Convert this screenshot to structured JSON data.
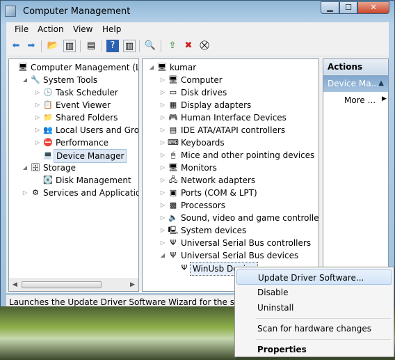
{
  "window": {
    "title": "Computer Management"
  },
  "menubar": {
    "items": [
      "File",
      "Action",
      "View",
      "Help"
    ]
  },
  "left_tree": [
    {
      "label": "Computer Management (Local",
      "indent": 0,
      "expander": "",
      "icon": "computer-icon"
    },
    {
      "label": "System Tools",
      "indent": 1,
      "expander": "◢",
      "icon": "tools-icon"
    },
    {
      "label": "Task Scheduler",
      "indent": 2,
      "expander": "▷",
      "icon": "clock-icon"
    },
    {
      "label": "Event Viewer",
      "indent": 2,
      "expander": "▷",
      "icon": "event-viewer-icon"
    },
    {
      "label": "Shared Folders",
      "indent": 2,
      "expander": "▷",
      "icon": "shared-folder-icon"
    },
    {
      "label": "Local Users and Groups",
      "indent": 2,
      "expander": "▷",
      "icon": "users-icon"
    },
    {
      "label": "Performance",
      "indent": 2,
      "expander": "▷",
      "icon": "performance-icon"
    },
    {
      "label": "Device Manager",
      "indent": 2,
      "expander": "",
      "icon": "device-manager-icon",
      "selected": true
    },
    {
      "label": "Storage",
      "indent": 1,
      "expander": "◢",
      "icon": "storage-icon"
    },
    {
      "label": "Disk Management",
      "indent": 2,
      "expander": "",
      "icon": "disk-icon"
    },
    {
      "label": "Services and Applications",
      "indent": 1,
      "expander": "▷",
      "icon": "services-icon"
    }
  ],
  "device_tree": [
    {
      "label": "kumar",
      "indent": 0,
      "expander": "◢",
      "icon": "computer-icon"
    },
    {
      "label": "Computer",
      "indent": 1,
      "expander": "▷",
      "icon": "monitor-icon"
    },
    {
      "label": "Disk drives",
      "indent": 1,
      "expander": "▷",
      "icon": "disk-drive-icon"
    },
    {
      "label": "Display adapters",
      "indent": 1,
      "expander": "▷",
      "icon": "display-adapter-icon"
    },
    {
      "label": "Human Interface Devices",
      "indent": 1,
      "expander": "▷",
      "icon": "hid-icon"
    },
    {
      "label": "IDE ATA/ATAPI controllers",
      "indent": 1,
      "expander": "▷",
      "icon": "ide-controller-icon"
    },
    {
      "label": "Keyboards",
      "indent": 1,
      "expander": "▷",
      "icon": "keyboard-icon"
    },
    {
      "label": "Mice and other pointing devices",
      "indent": 1,
      "expander": "▷",
      "icon": "mouse-icon"
    },
    {
      "label": "Monitors",
      "indent": 1,
      "expander": "▷",
      "icon": "monitor-icon"
    },
    {
      "label": "Network adapters",
      "indent": 1,
      "expander": "▷",
      "icon": "network-adapter-icon"
    },
    {
      "label": "Ports (COM & LPT)",
      "indent": 1,
      "expander": "▷",
      "icon": "port-icon"
    },
    {
      "label": "Processors",
      "indent": 1,
      "expander": "▷",
      "icon": "processor-icon"
    },
    {
      "label": "Sound, video and game controllers",
      "indent": 1,
      "expander": "▷",
      "icon": "sound-icon"
    },
    {
      "label": "System devices",
      "indent": 1,
      "expander": "▷",
      "icon": "system-device-icon"
    },
    {
      "label": "Universal Serial Bus controllers",
      "indent": 1,
      "expander": "▷",
      "icon": "usb-icon"
    },
    {
      "label": "Universal Serial Bus devices",
      "indent": 1,
      "expander": "◢",
      "icon": "usb-icon"
    },
    {
      "label": "WinUsb Device",
      "indent": 2,
      "expander": "",
      "icon": "usb-icon",
      "selected": true
    }
  ],
  "actions": {
    "header": "Actions",
    "item": "Device Ma...",
    "more": "More ..."
  },
  "status": {
    "text": "Launches the Update Driver Software Wizard for the selected d"
  },
  "context_menu": [
    {
      "label": "Update Driver Software...",
      "highlighted": true
    },
    {
      "label": "Disable"
    },
    {
      "label": "Uninstall"
    },
    {
      "separator": true
    },
    {
      "label": "Scan for hardware changes"
    },
    {
      "separator": true
    },
    {
      "label": "Properties",
      "bold": true
    }
  ],
  "icon_glyphs": {
    "computer-icon": "🖥",
    "tools-icon": "🔧",
    "clock-icon": "🕒",
    "event-viewer-icon": "📋",
    "shared-folder-icon": "📁",
    "users-icon": "👥",
    "performance-icon": "⛔",
    "device-manager-icon": "💻",
    "storage-icon": "🗄",
    "disk-icon": "💽",
    "services-icon": "⚙",
    "monitor-icon": "🖥",
    "disk-drive-icon": "▭",
    "display-adapter-icon": "▦",
    "hid-icon": "🎮",
    "ide-controller-icon": "▤",
    "keyboard-icon": "⌨",
    "mouse-icon": "🖱",
    "network-adapter-icon": "🖧",
    "port-icon": "▣",
    "processor-icon": "▩",
    "sound-icon": "🔈",
    "system-device-icon": "🖳",
    "usb-icon": "Ψ"
  }
}
